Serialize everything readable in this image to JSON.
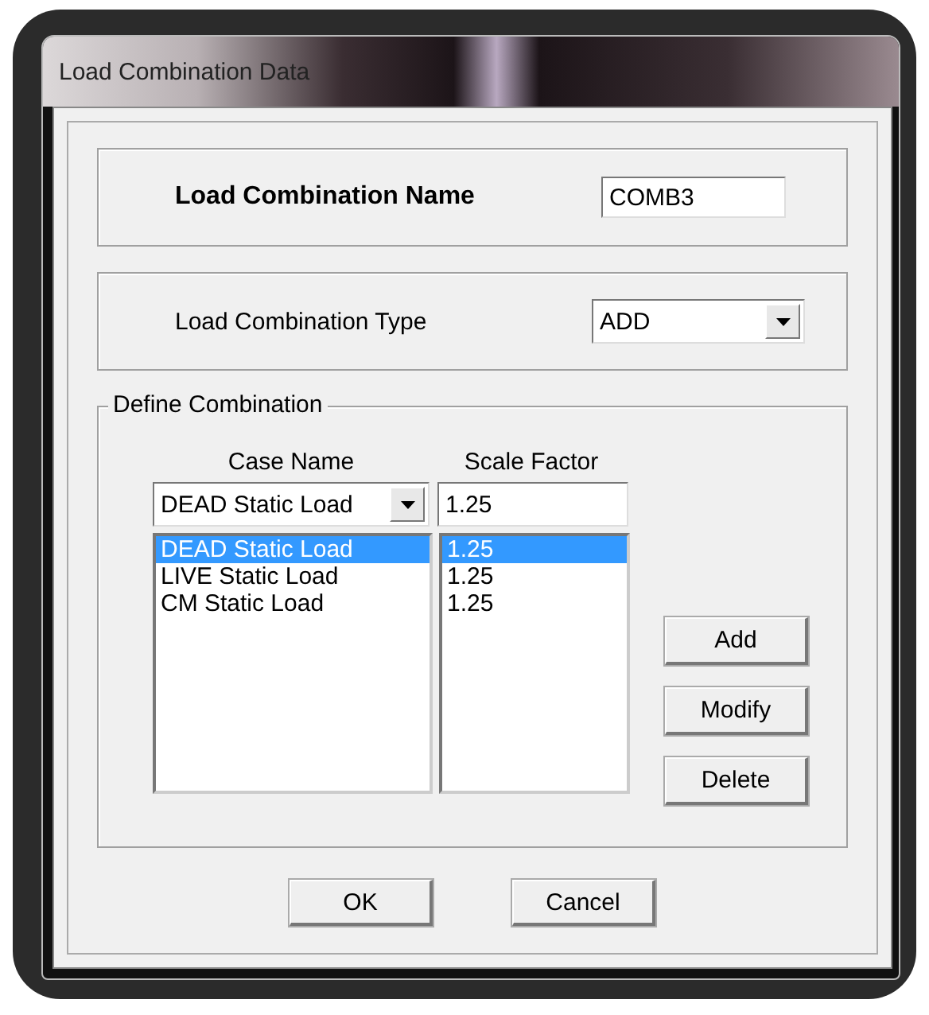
{
  "window": {
    "title": "Load Combination Data"
  },
  "name_field": {
    "label": "Load Combination Name",
    "value": "COMB3"
  },
  "type_field": {
    "label": "Load Combination Type",
    "value": "ADD"
  },
  "define_combination": {
    "title": "Define Combination",
    "case_column": "Case Name",
    "scale_column": "Scale Factor",
    "case_select": "DEAD Static Load",
    "scale_input": "1.25",
    "rows": [
      {
        "case": "DEAD Static Load",
        "scale": "1.25",
        "selected": true
      },
      {
        "case": "LIVE Static Load",
        "scale": "1.25",
        "selected": false
      },
      {
        "case": "CM Static Load",
        "scale": "1.25",
        "selected": false
      }
    ],
    "buttons": [
      "Add",
      "Modify",
      "Delete"
    ]
  },
  "dialog_buttons": [
    "OK",
    "Cancel"
  ]
}
